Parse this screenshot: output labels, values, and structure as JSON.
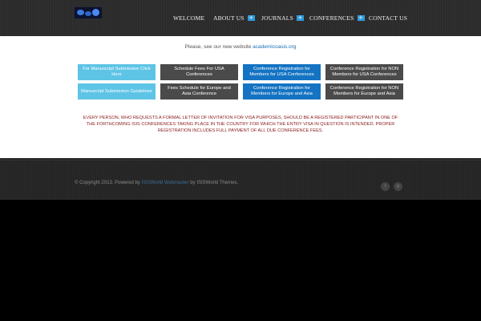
{
  "nav": {
    "items": [
      {
        "label": "WELCOME",
        "has_submenu": false
      },
      {
        "label": "ABOUT US",
        "has_submenu": true
      },
      {
        "label": "JOURNALS",
        "has_submenu": true
      },
      {
        "label": "CONFERENCES",
        "has_submenu": true
      },
      {
        "label": "CONTACT US",
        "has_submenu": false
      }
    ],
    "submenu_glyph": "+"
  },
  "notice": {
    "text": "Please, see our new website",
    "link_text": "academicoasis.org"
  },
  "buttons": [
    {
      "label": "For Manuscript Submission Click Here",
      "color": "#5ec4e6"
    },
    {
      "label": "Schedule Fees For USA Conferences",
      "color": "#4a4a4a"
    },
    {
      "label": "Conference Registration for Members for USA Conferences",
      "color": "#1473c2"
    },
    {
      "label": "Conference Registration for NON Members for USA Conferences",
      "color": "#4a4a4a"
    },
    {
      "label": "Manuscript Submission Guidelines",
      "color": "#5ec4e6"
    },
    {
      "label": "Fees Schedule for Europe and Asia Conference",
      "color": "#4a4a4a"
    },
    {
      "label": "Conference Registration for Members for Europe and Asia",
      "color": "#1473c2"
    },
    {
      "label": "Conference Registration for NON Members for Europe and Asia",
      "color": "#4a4a4a"
    }
  ],
  "warning": "EVERY PERSON, WHO REQUESTS A FORMAL LETTER OF INVITATION FOR VISA PURPOSES, SHOULD BE A REGISTERED PARTICIPANT IN ONE OF THE FORTHCOMING ISIS CONFERENCES TAKING PLACE IN THE COUNTRY FOR WHICH THE ENTRY VISA IN QUESTION IS INTENDED. PROPER REGISTRATION INCLUDES FULL PAYMENT OF ALL DUE CONFERENCE FEES.",
  "footer": {
    "copyright_prefix": "© Copyright 2013. Powered by",
    "powered_link": "ISISWorld Webmaster",
    "by_text": "by",
    "themes": "ISISWorld Themes."
  },
  "social": [
    {
      "icon": "twitter-icon",
      "glyph": "t"
    },
    {
      "icon": "google-plus-icon",
      "glyph": "g"
    }
  ],
  "colors": {
    "accent": "#2f9bdc",
    "warning_text": "#8b1a1a",
    "link": "#1a6fb5"
  }
}
